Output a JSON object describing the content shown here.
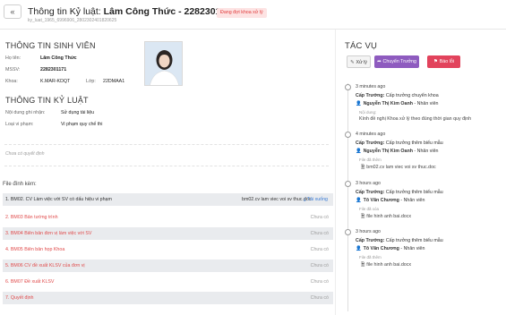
{
  "header": {
    "back_icon": "double-chevron-left-icon",
    "title_prefix": "Thông tin Kỷ luật:",
    "title_name": "Lâm Công Thức - 2282301171",
    "status": "Đang đợi khoa xử lý",
    "sub_id": "ky_luat_1965_6996906_2802302401820625"
  },
  "student": {
    "section": "THÔNG TIN SINH VIÊN",
    "name_label": "Họ tên:",
    "name_value": "Lâm Công Thức",
    "mssv_label": "MSSV:",
    "mssv_value": "2282301171",
    "khoa_label": "Khoa:",
    "khoa_value": "K.MAR-KDQT",
    "lop_label": "Lớp:",
    "lop_value": "22DMAA1"
  },
  "discipline": {
    "section": "THÔNG TIN KỶ LUẬT",
    "content_label": "Nội dung ghi nhận:",
    "content_value": "Sử dụng tài liệu",
    "type_label": "Loại vi phạm:",
    "type_value": "Vi phạm quy chế thi",
    "no_decision": "Chưa có quyết định"
  },
  "attachments": {
    "title": "File đính kèm:",
    "download_icon": "download-icon",
    "rows": [
      {
        "name": "1. BM02. CV Làm việc với SV có dấu hiệu vi phạm",
        "doc": "bm02.cv lam viec voi sv thuc.doc",
        "action": "Tải xuống",
        "status": ""
      },
      {
        "name": "2. BM03 Bản tường trình",
        "doc": "",
        "action": "",
        "status": "Chưa có"
      },
      {
        "name": "3. BM04 Biên bản đơn vị làm việc với SV",
        "doc": "",
        "action": "",
        "status": "Chưa có"
      },
      {
        "name": "4. BM05 Biên bản họp Khoa",
        "doc": "",
        "action": "",
        "status": "Chưa có"
      },
      {
        "name": "5. BM06 CV đề xuất KLSV của đơn vị",
        "doc": "",
        "action": "",
        "status": "Chưa có"
      },
      {
        "name": "6. BM07 Đề xuất KLSV",
        "doc": "",
        "action": "",
        "status": "Chưa có"
      },
      {
        "name": "7. Quyết định",
        "doc": "",
        "action": "",
        "status": "Chưa có"
      }
    ]
  },
  "actions": {
    "title": "TÁC VỤ",
    "process": "Xử lý",
    "forward": "Chuyển Trưởng",
    "report": "Báo lỗi",
    "process_icon": "edit-icon",
    "forward_icon": "forward-icon",
    "report_icon": "alert-icon"
  },
  "timeline": [
    {
      "time": "3 minutes ago",
      "role": "Cấp Trưởng:",
      "text": "Cấp trưởng chuyển khoa",
      "person": "Nguyễn Thị Kim Oanh",
      "person_role": " - Nhân viên",
      "sub_label": "Nội dung:",
      "content": "Kính đề nghị Khoa xử lý theo đúng thời gian quy định",
      "file": ""
    },
    {
      "time": "4 minutes ago",
      "role": "Cấp Trưởng:",
      "text": "Cấp trưởng thêm biểu mẫu",
      "person": "Nguyễn Thị Kim Oanh",
      "person_role": " - Nhân viên",
      "sub_label": "File đã thêm",
      "content": "",
      "file": "bm02.cv lam viec voi sv thuc.doc"
    },
    {
      "time": "3 hours ago",
      "role": "Cấp Trưởng:",
      "text": "Cấp trưởng thêm biểu mẫu",
      "person": "Tô Văn Chương",
      "person_role": " - Nhân viên",
      "sub_label": "File đã xóa",
      "content": "",
      "file": "file hinh anh bai.docx"
    },
    {
      "time": "3 hours ago",
      "role": "Cấp Trưởng:",
      "text": "Cấp trưởng thêm biểu mẫu",
      "person": "Tô Văn Chương",
      "person_role": " - Nhân viên",
      "sub_label": "File đã thêm",
      "content": "",
      "file": "file hinh anh bai.docx"
    }
  ],
  "icons": {
    "timeline_dot": "timeline-dot-icon",
    "person": "user-icon",
    "file": "file-icon"
  }
}
